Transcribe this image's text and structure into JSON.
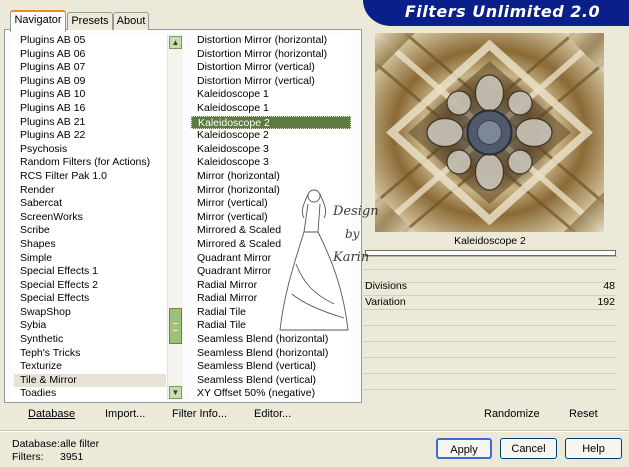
{
  "header": {
    "title": "Filters Unlimited 2.0"
  },
  "tabs": [
    {
      "label": "Navigator",
      "active": true
    },
    {
      "label": "Presets",
      "active": false
    },
    {
      "label": "About",
      "active": false
    }
  ],
  "categories": [
    "Plugins AB 05",
    "Plugins AB 06",
    "Plugins AB 07",
    "Plugins AB 09",
    "Plugins AB 10",
    "Plugins AB 16",
    "Plugins AB 21",
    "Plugins AB 22",
    "Psychosis",
    "Random Filters (for Actions)",
    "RCS Filter Pak 1.0",
    "Render",
    "Sabercat",
    "ScreenWorks",
    "Scribe",
    "Shapes",
    "Simple",
    "Special Effects 1",
    "Special Effects 2",
    "Special Effects",
    "SwapShop",
    "Sybia",
    "Synthetic",
    "Teph's Tricks",
    "Texturize",
    "Tile & Mirror",
    "Toadies"
  ],
  "selected_category": "Tile & Mirror",
  "filters": [
    "Distortion Mirror (horizontal)",
    "Distortion Mirror (horizontal)",
    "Distortion Mirror (vertical)",
    "Distortion Mirror (vertical)",
    "Kaleidoscope 1",
    "Kaleidoscope 1",
    "Kaleidoscope 2",
    "Kaleidoscope 2",
    "Kaleidoscope 3",
    "Kaleidoscope 3",
    "Mirror (horizontal)",
    "Mirror (horizontal)",
    "Mirror (vertical)",
    "Mirror (vertical)",
    "Mirrored & Scaled",
    "Mirrored & Scaled",
    "Quadrant Mirror",
    "Quadrant Mirror",
    "Radial Mirror",
    "Radial Mirror",
    "Radial Tile",
    "Radial Tile",
    "Seamless Blend (horizontal)",
    "Seamless Blend (horizontal)",
    "Seamless Blend (vertical)",
    "Seamless Blend (vertical)",
    "XY Offset 50% (negative)"
  ],
  "selected_filter": "Kaleidoscope 2",
  "filter_name": "Kaleidoscope 2",
  "params": [
    {
      "label": "Divisions",
      "value": "48"
    },
    {
      "label": "Variation",
      "value": "192"
    }
  ],
  "nav_buttons": {
    "database": "Database",
    "import": "Import...",
    "filter_info": "Filter Info...",
    "editor": "Editor...",
    "randomize": "Randomize",
    "reset": "Reset"
  },
  "status": {
    "database_label": "Database:",
    "database_value": "alle filter",
    "filters_label": "Filters:",
    "filters_value": "3951"
  },
  "buttons": {
    "apply": "Apply",
    "cancel": "Cancel",
    "help": "Help"
  },
  "watermark": {
    "line1": "Design",
    "line2": "by",
    "line3": "Karin"
  },
  "colors": {
    "banner": "#0a1f8a",
    "selection_green": "#5d7a40",
    "dialog_bg": "#ece9d8"
  }
}
